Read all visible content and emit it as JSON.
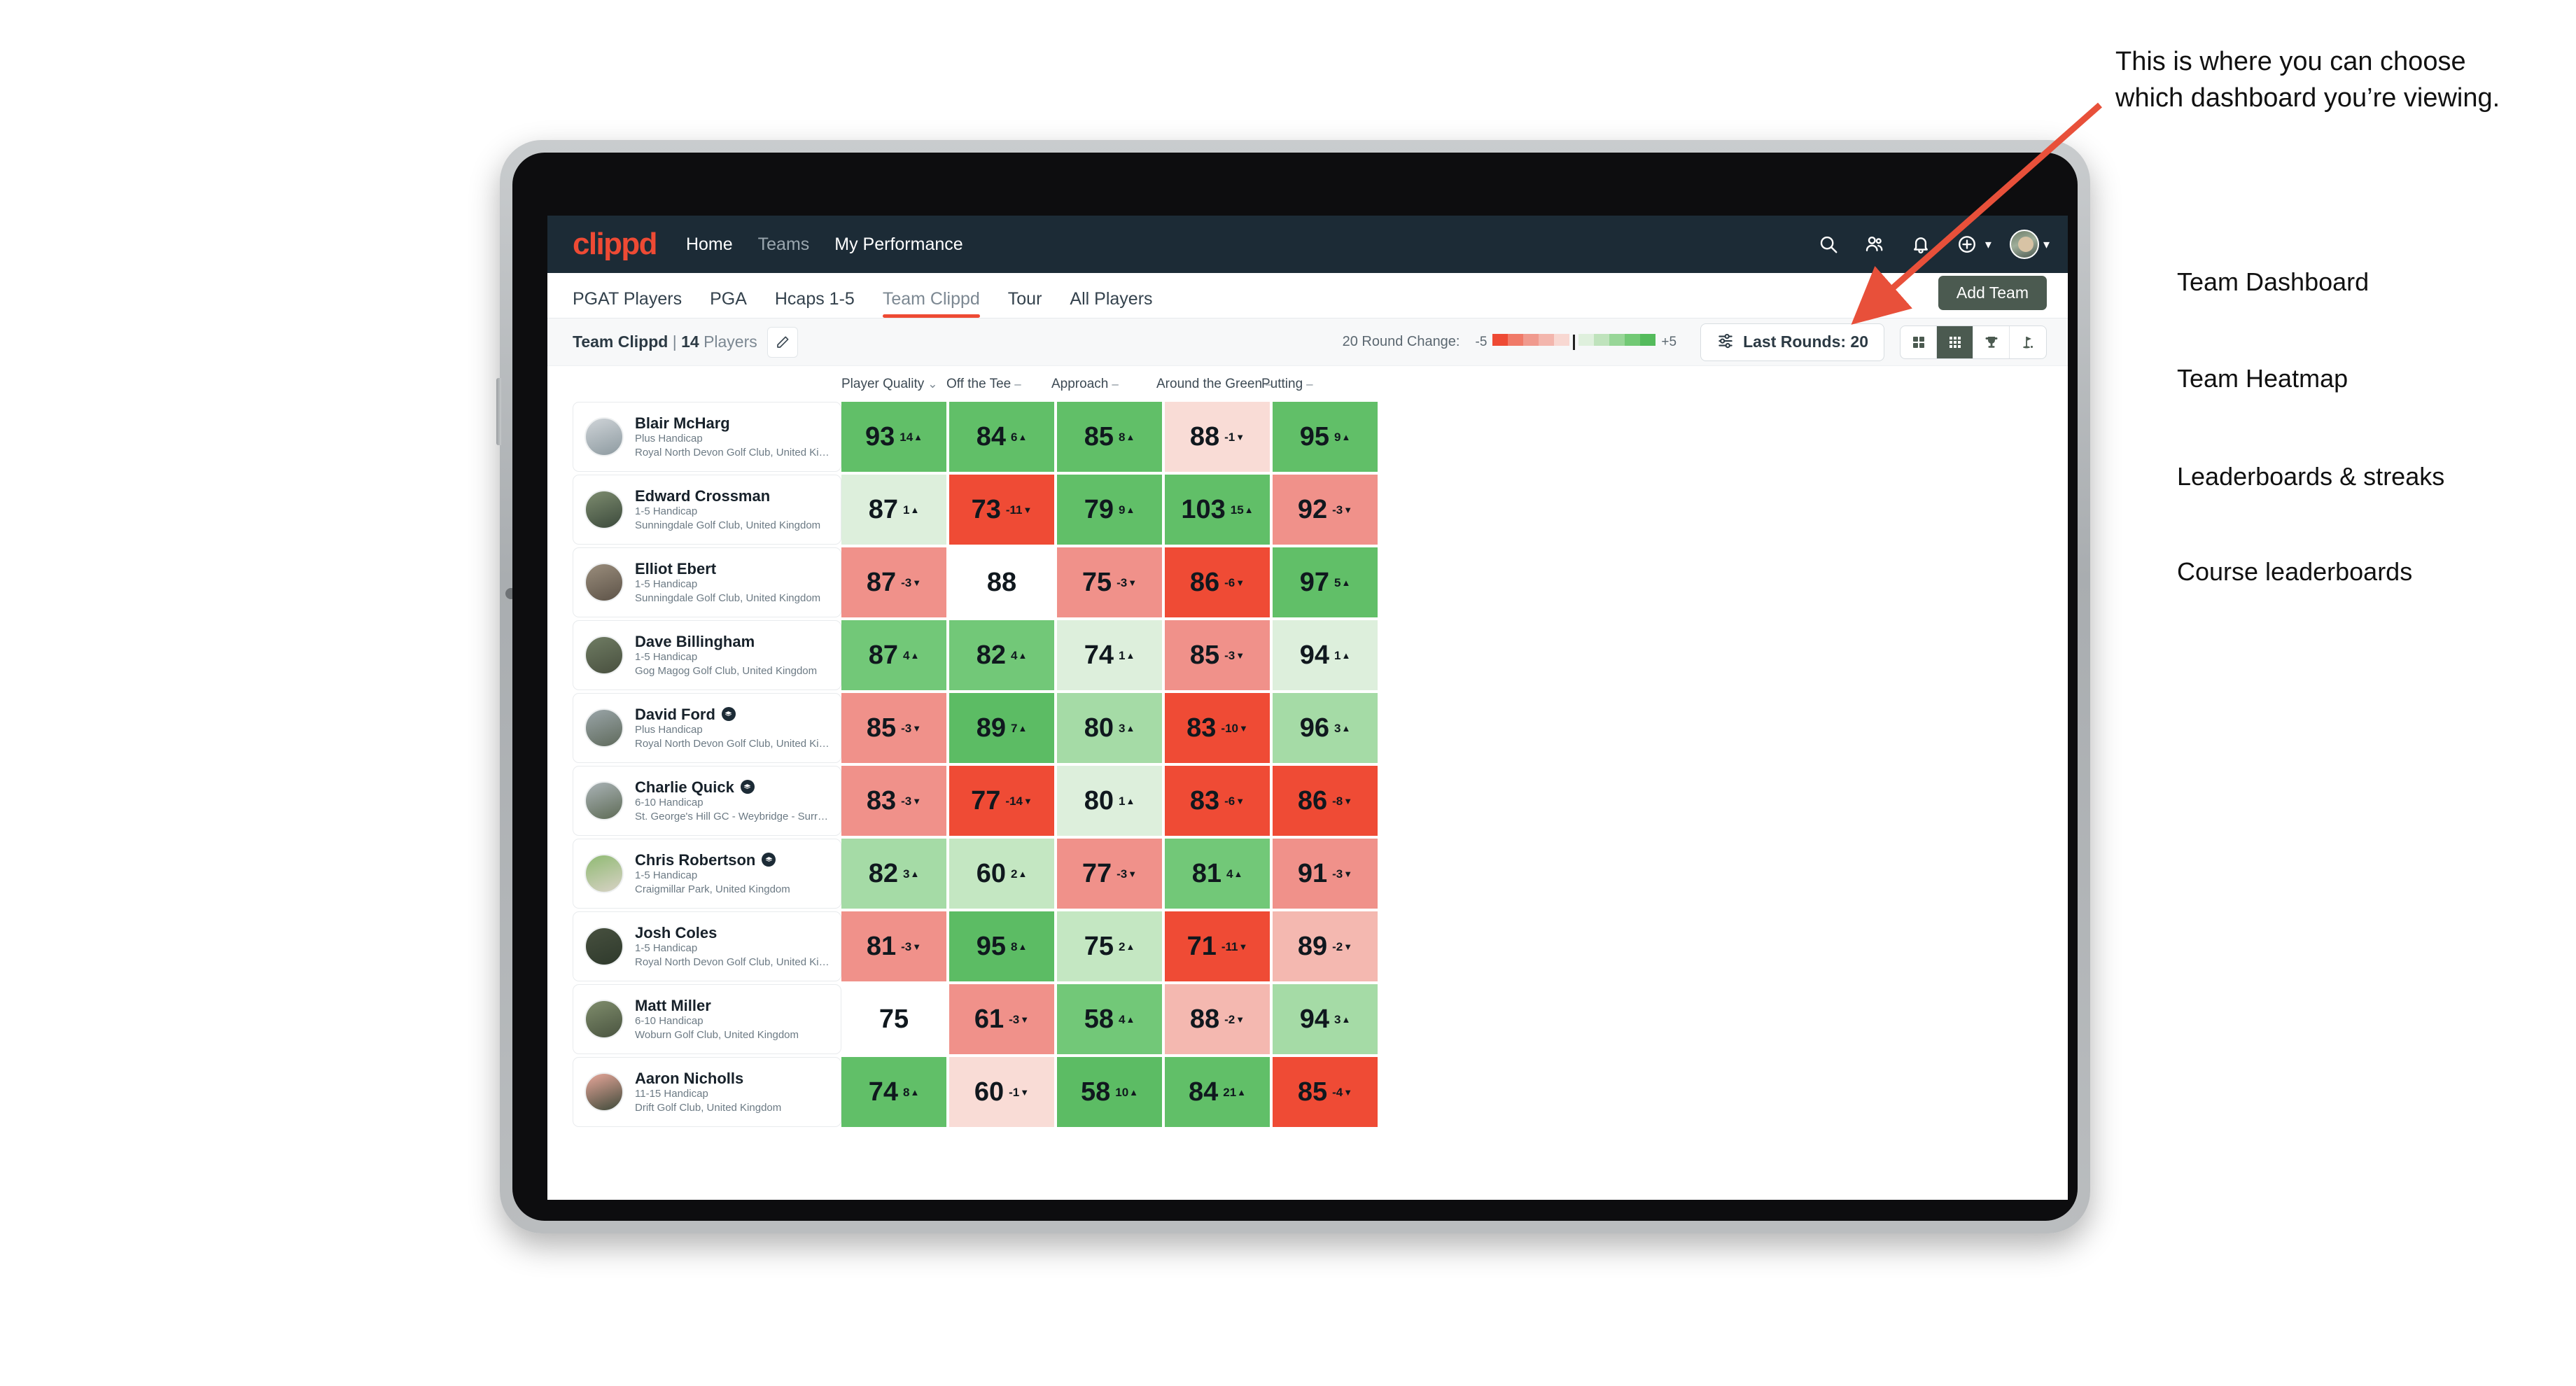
{
  "topnav": {
    "logo": "clippd",
    "links": [
      {
        "label": "Home",
        "dim": false
      },
      {
        "label": "Teams",
        "dim": true
      },
      {
        "label": "My Performance",
        "dim": false
      }
    ],
    "icons": [
      "search-icon",
      "people-icon",
      "bell-icon",
      "plus-circle-icon",
      "avatar"
    ]
  },
  "tabs": [
    {
      "label": "PGAT Players",
      "active": false
    },
    {
      "label": "PGA",
      "active": false
    },
    {
      "label": "Hcaps 1-5",
      "active": false
    },
    {
      "label": "Team Clippd",
      "active": true
    },
    {
      "label": "Tour",
      "active": false
    },
    {
      "label": "All Players",
      "active": false
    }
  ],
  "add_team_button": "Add Team",
  "toolbar": {
    "team_name": "Team Clippd",
    "separator": "|",
    "player_count": "14",
    "players_word": "Players",
    "edit_icon": "pencil-icon",
    "legend_label": "20 Round Change:",
    "legend_min": "-5",
    "legend_max": "+5",
    "rounds_button": "Last Rounds: 20",
    "rounds_icon": "sliders-icon",
    "view_toggles": [
      {
        "icon": "grid-2x2-icon",
        "active": false
      },
      {
        "icon": "grid-3x3-icon",
        "active": true
      },
      {
        "icon": "trophy-icon",
        "active": false
      },
      {
        "icon": "golf-flag-icon",
        "active": false
      }
    ]
  },
  "columns": [
    {
      "label": "Player Quality",
      "sym": "⌄"
    },
    {
      "label": "Off the Tee",
      "sym": "–"
    },
    {
      "label": "Approach",
      "sym": "–"
    },
    {
      "label": "Around the Green",
      "sym": "–"
    },
    {
      "label": "Putting",
      "sym": "–"
    }
  ],
  "legend_colors": {
    "negative": [
      "#ee4a34",
      "#f07a68",
      "#f09a8e",
      "#f3b6ad",
      "#f8d8d2"
    ],
    "positive": [
      "#dff0dd",
      "#bfe3bc",
      "#98d698",
      "#72c975",
      "#54bb5c"
    ]
  },
  "players": [
    {
      "name": "Blair McHarg",
      "verified": false,
      "handicap": "Plus Handicap",
      "club": "Royal North Devon Golf Club, United Kingdom",
      "avatar_colors": [
        "#cfd4d8",
        "#8d9aa0"
      ],
      "cells": [
        {
          "value": "93",
          "delta": "14",
          "dir": "up",
          "bg": "#61bf68"
        },
        {
          "value": "84",
          "delta": "6",
          "dir": "up",
          "bg": "#61bf68"
        },
        {
          "value": "85",
          "delta": "8",
          "dir": "up",
          "bg": "#61bf68"
        },
        {
          "value": "88",
          "delta": "-1",
          "dir": "down",
          "bg": "#f9dcd6"
        },
        {
          "value": "95",
          "delta": "9",
          "dir": "up",
          "bg": "#61bf68"
        }
      ]
    },
    {
      "name": "Edward Crossman",
      "verified": false,
      "handicap": "1-5 Handicap",
      "club": "Sunningdale Golf Club, United Kingdom",
      "avatar_colors": [
        "#7d8c6f",
        "#3c4a3c"
      ],
      "cells": [
        {
          "value": "87",
          "delta": "1",
          "dir": "up",
          "bg": "#ddefdc"
        },
        {
          "value": "73",
          "delta": "-11",
          "dir": "down",
          "bg": "#ef4b35"
        },
        {
          "value": "79",
          "delta": "9",
          "dir": "up",
          "bg": "#61bf68"
        },
        {
          "value": "103",
          "delta": "15",
          "dir": "up",
          "bg": "#61bf68"
        },
        {
          "value": "92",
          "delta": "-3",
          "dir": "down",
          "bg": "#f0918a"
        }
      ]
    },
    {
      "name": "Elliot Ebert",
      "verified": false,
      "handicap": "1-5 Handicap",
      "club": "Sunningdale Golf Club, United Kingdom",
      "avatar_colors": [
        "#9a8d7c",
        "#5d5348"
      ],
      "cells": [
        {
          "value": "87",
          "delta": "-3",
          "dir": "down",
          "bg": "#f0918a"
        },
        {
          "value": "88",
          "delta": "",
          "dir": "",
          "bg": "#ffffff"
        },
        {
          "value": "75",
          "delta": "-3",
          "dir": "down",
          "bg": "#f0918a"
        },
        {
          "value": "86",
          "delta": "-6",
          "dir": "down",
          "bg": "#ef4b35"
        },
        {
          "value": "97",
          "delta": "5",
          "dir": "up",
          "bg": "#61bf68"
        }
      ]
    },
    {
      "name": "Dave Billingham",
      "verified": false,
      "handicap": "1-5 Handicap",
      "club": "Gog Magog Golf Club, United Kingdom",
      "avatar_colors": [
        "#6f7c63",
        "#49503f"
      ],
      "cells": [
        {
          "value": "87",
          "delta": "4",
          "dir": "up",
          "bg": "#72c878"
        },
        {
          "value": "82",
          "delta": "4",
          "dir": "up",
          "bg": "#72c878"
        },
        {
          "value": "74",
          "delta": "1",
          "dir": "up",
          "bg": "#ddefdc"
        },
        {
          "value": "85",
          "delta": "-3",
          "dir": "down",
          "bg": "#f0918a"
        },
        {
          "value": "94",
          "delta": "1",
          "dir": "up",
          "bg": "#ddefdc"
        }
      ]
    },
    {
      "name": "David Ford",
      "verified": true,
      "handicap": "Plus Handicap",
      "club": "Royal North Devon Golf Club, United Kingdom",
      "avatar_colors": [
        "#9aa5a8",
        "#5f6a5c"
      ],
      "cells": [
        {
          "value": "85",
          "delta": "-3",
          "dir": "down",
          "bg": "#f0918a"
        },
        {
          "value": "89",
          "delta": "7",
          "dir": "up",
          "bg": "#5cbc64"
        },
        {
          "value": "80",
          "delta": "3",
          "dir": "up",
          "bg": "#a5dba6"
        },
        {
          "value": "83",
          "delta": "-10",
          "dir": "down",
          "bg": "#ef4b35"
        },
        {
          "value": "96",
          "delta": "3",
          "dir": "up",
          "bg": "#a5dba6"
        }
      ]
    },
    {
      "name": "Charlie Quick",
      "verified": true,
      "handicap": "6-10 Handicap",
      "club": "St. George's Hill GC - Weybridge - Surrey, Uni...",
      "avatar_colors": [
        "#aab3b6",
        "#5e6b56"
      ],
      "cells": [
        {
          "value": "83",
          "delta": "-3",
          "dir": "down",
          "bg": "#f0918a"
        },
        {
          "value": "77",
          "delta": "-14",
          "dir": "down",
          "bg": "#ef4b35"
        },
        {
          "value": "80",
          "delta": "1",
          "dir": "up",
          "bg": "#ddefdc"
        },
        {
          "value": "83",
          "delta": "-6",
          "dir": "down",
          "bg": "#ef4b35"
        },
        {
          "value": "86",
          "delta": "-8",
          "dir": "down",
          "bg": "#ef4b35"
        }
      ]
    },
    {
      "name": "Chris Robertson",
      "verified": true,
      "handicap": "1-5 Handicap",
      "club": "Craigmillar Park, United Kingdom",
      "avatar_colors": [
        "#8fba72",
        "#d8d2c6"
      ],
      "cells": [
        {
          "value": "82",
          "delta": "3",
          "dir": "up",
          "bg": "#a5dba6"
        },
        {
          "value": "60",
          "delta": "2",
          "dir": "up",
          "bg": "#c4e7c2"
        },
        {
          "value": "77",
          "delta": "-3",
          "dir": "down",
          "bg": "#f0918a"
        },
        {
          "value": "81",
          "delta": "4",
          "dir": "up",
          "bg": "#72c878"
        },
        {
          "value": "91",
          "delta": "-3",
          "dir": "down",
          "bg": "#f0918a"
        }
      ]
    },
    {
      "name": "Josh Coles",
      "verified": false,
      "handicap": "1-5 Handicap",
      "club": "Royal North Devon Golf Club, United Kingdom",
      "avatar_colors": [
        "#47503f",
        "#2f3a2c"
      ],
      "cells": [
        {
          "value": "81",
          "delta": "-3",
          "dir": "down",
          "bg": "#f0918a"
        },
        {
          "value": "95",
          "delta": "8",
          "dir": "up",
          "bg": "#5cbc64"
        },
        {
          "value": "75",
          "delta": "2",
          "dir": "up",
          "bg": "#c4e7c2"
        },
        {
          "value": "71",
          "delta": "-11",
          "dir": "down",
          "bg": "#ef4b35"
        },
        {
          "value": "89",
          "delta": "-2",
          "dir": "down",
          "bg": "#f4b8b0"
        }
      ]
    },
    {
      "name": "Matt Miller",
      "verified": false,
      "handicap": "6-10 Handicap",
      "club": "Woburn Golf Club, United Kingdom",
      "avatar_colors": [
        "#7f8d6c",
        "#4a5440"
      ],
      "cells": [
        {
          "value": "75",
          "delta": "",
          "dir": "",
          "bg": "#ffffff"
        },
        {
          "value": "61",
          "delta": "-3",
          "dir": "down",
          "bg": "#f0918a"
        },
        {
          "value": "58",
          "delta": "4",
          "dir": "up",
          "bg": "#72c878"
        },
        {
          "value": "88",
          "delta": "-2",
          "dir": "down",
          "bg": "#f4b8b0"
        },
        {
          "value": "94",
          "delta": "3",
          "dir": "up",
          "bg": "#a5dba6"
        }
      ]
    },
    {
      "name": "Aaron Nicholls",
      "verified": false,
      "handicap": "11-15 Handicap",
      "club": "Drift Golf Club, United Kingdom",
      "avatar_colors": [
        "#e8a79a",
        "#3f4a3a"
      ],
      "cells": [
        {
          "value": "74",
          "delta": "8",
          "dir": "up",
          "bg": "#61bf68"
        },
        {
          "value": "60",
          "delta": "-1",
          "dir": "down",
          "bg": "#f9dcd6"
        },
        {
          "value": "58",
          "delta": "10",
          "dir": "up",
          "bg": "#5cbc64"
        },
        {
          "value": "84",
          "delta": "21",
          "dir": "up",
          "bg": "#61bf68"
        },
        {
          "value": "85",
          "delta": "-4",
          "dir": "down",
          "bg": "#ef4b35"
        }
      ]
    }
  ],
  "annotation": {
    "paragraph": "This is where you can choose which dashboard you’re viewing.",
    "items": [
      "Team Dashboard",
      "Team Heatmap",
      "Leaderboards & streaks",
      "Course leaderboards"
    ],
    "arrow_color": "#e8503a"
  }
}
